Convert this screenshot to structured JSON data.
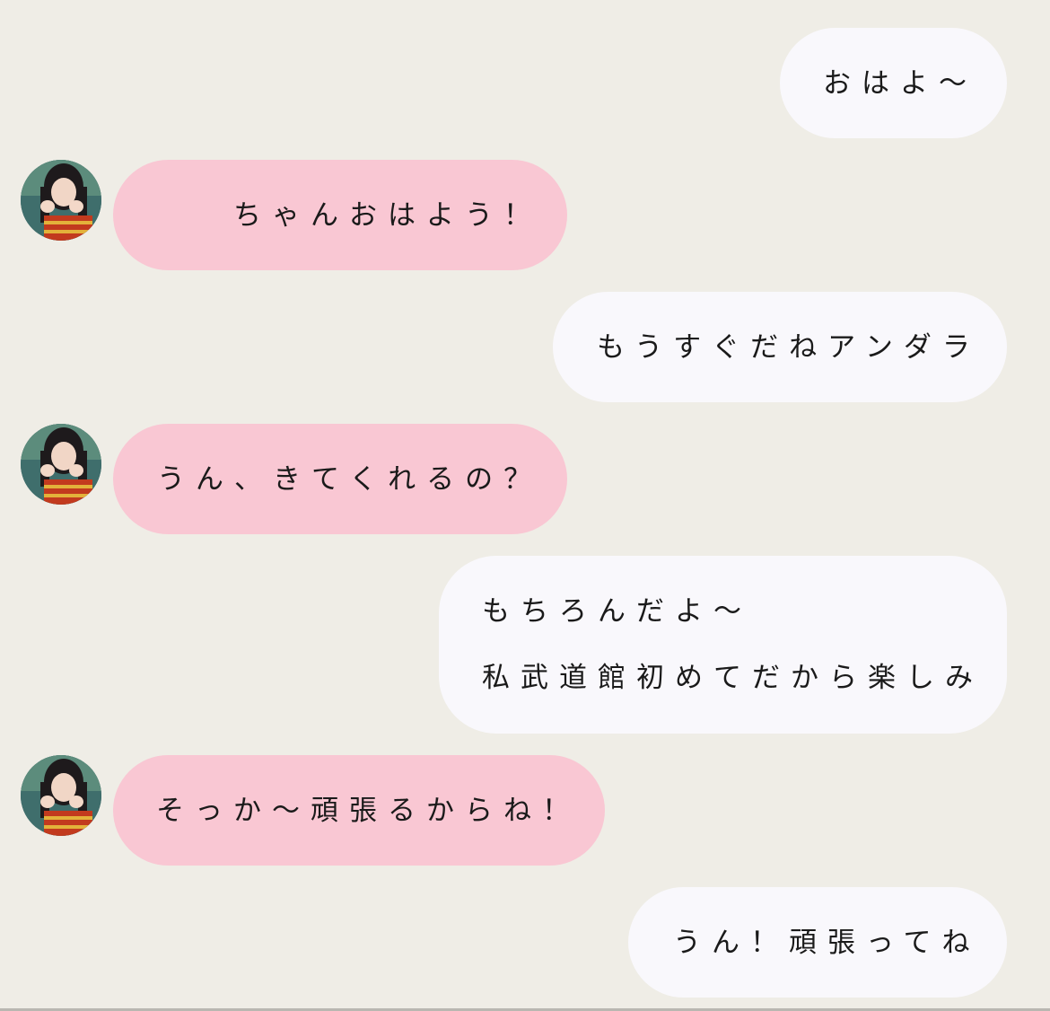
{
  "messages": [
    {
      "sender": "me",
      "lines": [
        "おはよ〜"
      ]
    },
    {
      "sender": "them",
      "lines": [
        "ちゃんおはよう！"
      ]
    },
    {
      "sender": "me",
      "lines": [
        "もうすぐだねアンダラ"
      ]
    },
    {
      "sender": "them",
      "lines": [
        "うん、きてくれるの？"
      ]
    },
    {
      "sender": "me",
      "lines": [
        "もちろんだよ〜",
        "私武道館初めてだから楽しみ"
      ]
    },
    {
      "sender": "them",
      "lines": [
        "そっか〜頑張るからね！"
      ]
    },
    {
      "sender": "me",
      "lines": [
        "うん！頑張ってね"
      ]
    }
  ],
  "colors": {
    "background": "#efede6",
    "my_bubble": "#f9f8fc",
    "their_bubble": "#f9c7d3"
  }
}
